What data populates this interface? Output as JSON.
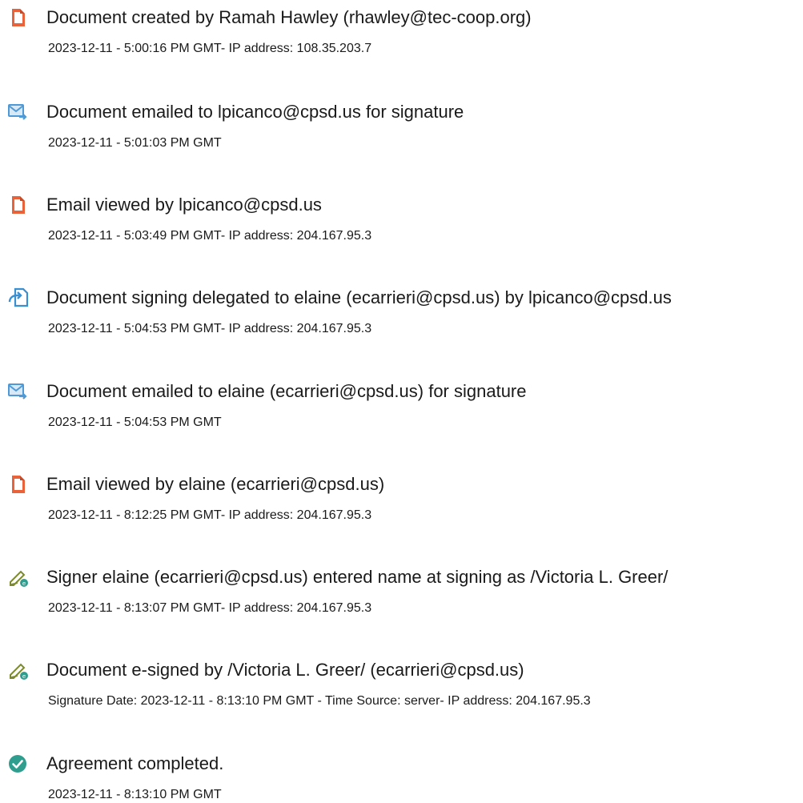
{
  "events": [
    {
      "icon": "document-icon",
      "title": "Document created by Ramah Hawley (rhawley@tec-coop.org)",
      "meta": "2023-12-11 - 5:00:16 PM GMT- IP address: 108.35.203.7"
    },
    {
      "icon": "email-send-icon",
      "title": "Document emailed to lpicanco@cpsd.us for signature",
      "meta": "2023-12-11 - 5:01:03 PM GMT"
    },
    {
      "icon": "document-icon",
      "title": "Email viewed by lpicanco@cpsd.us",
      "meta": "2023-12-11 - 5:03:49 PM GMT- IP address: 204.167.95.3"
    },
    {
      "icon": "delegate-icon",
      "title": "Document signing delegated to elaine (ecarrieri@cpsd.us) by lpicanco@cpsd.us",
      "meta": "2023-12-11 - 5:04:53 PM GMT- IP address: 204.167.95.3"
    },
    {
      "icon": "email-send-icon",
      "title": "Document emailed to elaine (ecarrieri@cpsd.us) for signature",
      "meta": "2023-12-11 - 5:04:53 PM GMT"
    },
    {
      "icon": "document-icon",
      "title": "Email viewed by elaine (ecarrieri@cpsd.us)",
      "meta": "2023-12-11 - 8:12:25 PM GMT- IP address: 204.167.95.3"
    },
    {
      "icon": "pen-sign-icon",
      "title": "Signer elaine (ecarrieri@cpsd.us) entered name at signing as /Victoria L. Greer/",
      "meta": "2023-12-11 - 8:13:07 PM GMT- IP address: 204.167.95.3"
    },
    {
      "icon": "pen-sign-icon",
      "title": "Document e-signed by /Victoria L. Greer/ (ecarrieri@cpsd.us)",
      "meta": "Signature Date: 2023-12-11 - 8:13:10 PM GMT - Time Source: server- IP address: 204.167.95.3"
    },
    {
      "icon": "check-circle-icon",
      "title": "Agreement completed.",
      "meta": "2023-12-11 - 8:13:10 PM GMT"
    }
  ],
  "colors": {
    "document": "#e9623a",
    "email": "#4f9ad6",
    "delegate": "#3a8fd1",
    "pen": "#7d8a2f",
    "check": "#2f9e8f"
  }
}
